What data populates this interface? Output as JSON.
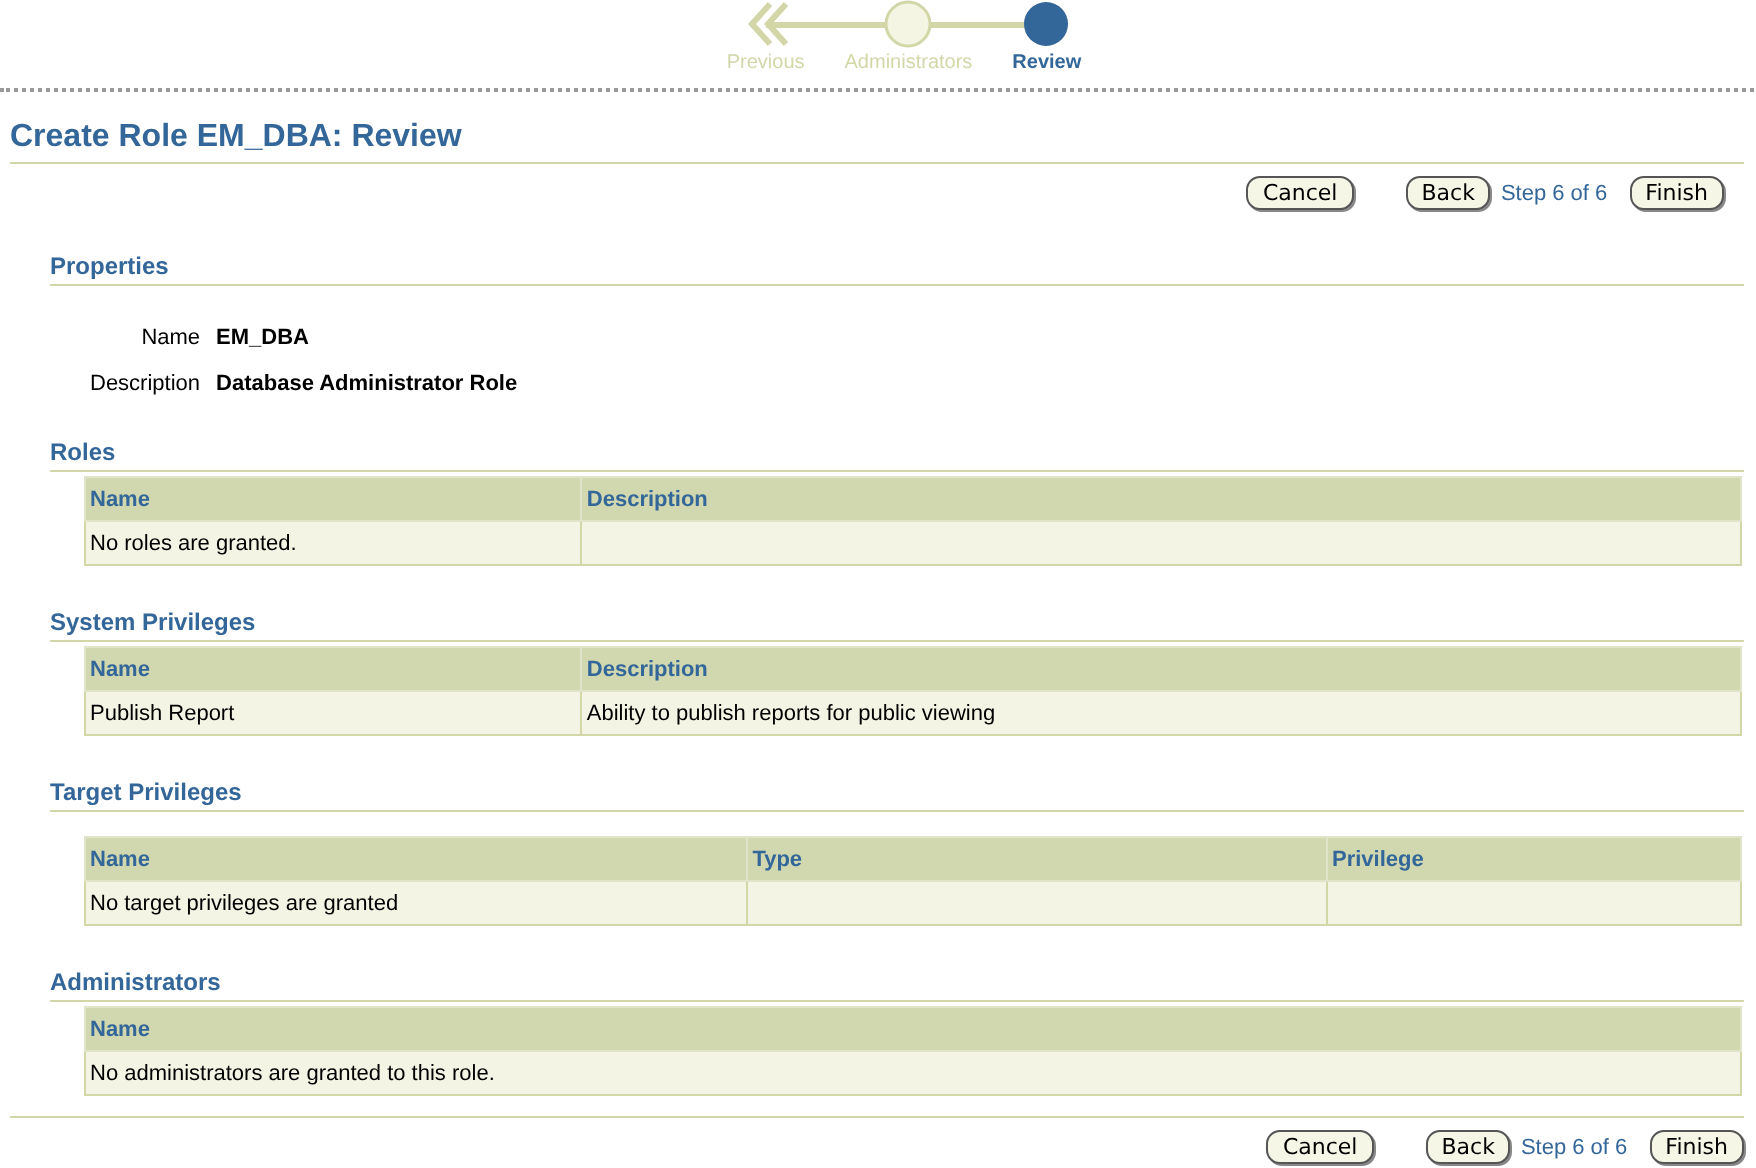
{
  "train": [
    {
      "label": "Previous",
      "kind": "back",
      "selected": false
    },
    {
      "label": "Administrators",
      "kind": "step",
      "selected": false
    },
    {
      "label": "Review",
      "kind": "step",
      "selected": true
    }
  ],
  "title": "Create Role EM_DBA: Review",
  "actions": {
    "cancel": "Cancel",
    "back": "Back",
    "step": "Step 6 of 6",
    "finish": "Finish"
  },
  "sections": [
    {
      "heading": "Properties",
      "kind": "fields",
      "fields": [
        {
          "label": "Name",
          "value": "EM_DBA"
        },
        {
          "label": "Description",
          "value": "Database Administrator Role"
        }
      ]
    },
    {
      "heading": "Roles",
      "kind": "table",
      "columns": [
        "Name",
        "Description"
      ],
      "rows": [
        [
          "No roles are granted."
        ]
      ]
    },
    {
      "heading": "System Privileges",
      "kind": "table",
      "columns": [
        "Name",
        "Description"
      ],
      "rows": [
        [
          "Publish Report",
          "Ability to publish reports for public viewing"
        ]
      ]
    },
    {
      "heading": "Target Privileges",
      "kind": "table",
      "columns": [
        "Name",
        "Type",
        "Privilege"
      ],
      "rows": [
        [
          "No target privileges are granted"
        ]
      ]
    },
    {
      "heading": "Administrators",
      "kind": "table",
      "columns": [
        "Name"
      ],
      "rows": [
        [
          "No administrators are granted to this role."
        ]
      ]
    }
  ],
  "bottom_actions": {
    "cancel": "Cancel",
    "back": "Back",
    "step": "Step 6 of 6",
    "finish": "Finish"
  }
}
